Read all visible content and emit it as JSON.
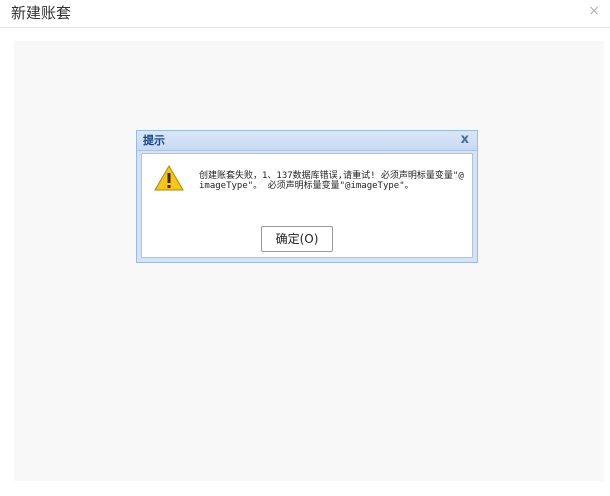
{
  "window": {
    "title": "新建账套",
    "close_glyph": "×"
  },
  "dialog": {
    "title": "提示",
    "close_glyph": "x",
    "icon": "warning-icon",
    "message": "创建账套失败，1、137数据库错误,请重试! 必须声明标量变量\"@imageType\"。 必须声明标量变量\"@imageType\"。",
    "ok_button_label": "确定(O)"
  },
  "colors": {
    "dialog_title": "#15428b",
    "dialog_border": "#99bbe8",
    "warning_yellow": "#f5c518"
  }
}
